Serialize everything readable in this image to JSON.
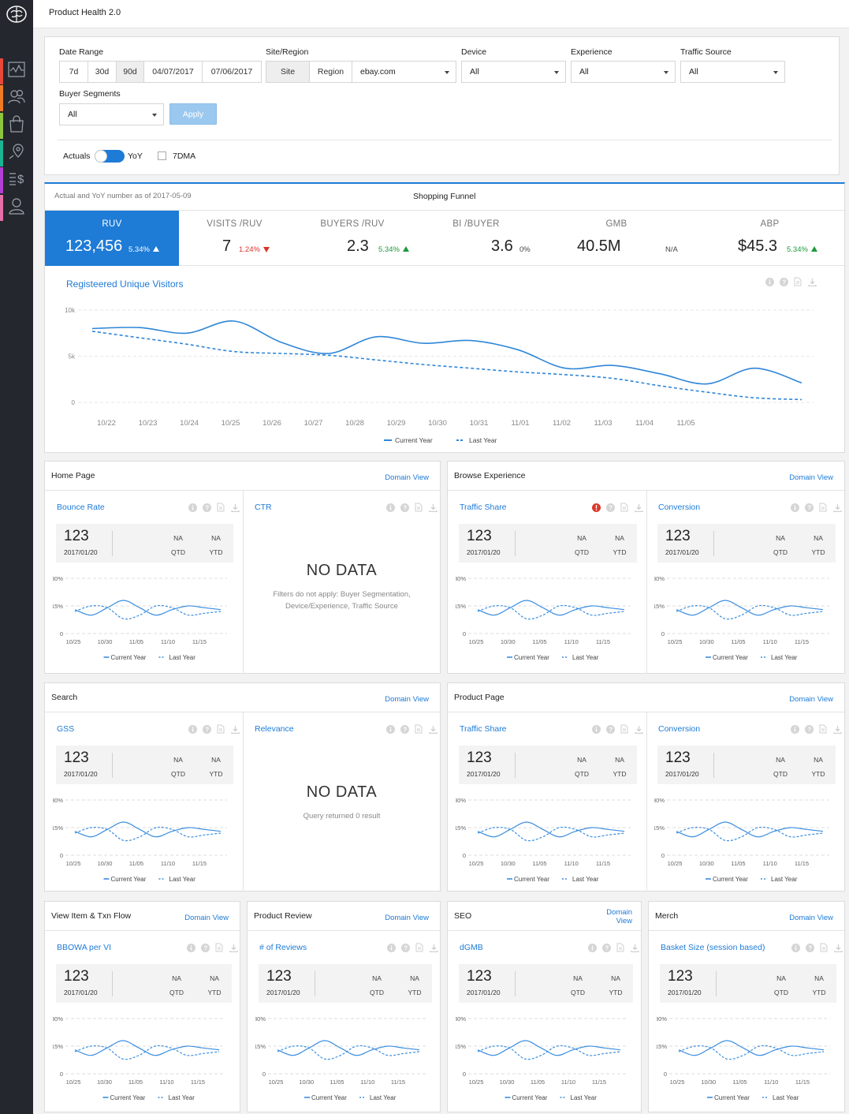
{
  "header": {
    "title": "Product Health 2.0"
  },
  "colors": {
    "accent": "#1e7bd6",
    "sidebar": "#24272d",
    "up": "#1c9a3a",
    "down": "#d9342b",
    "nav_bars": [
      "#e8483b",
      "#f07b22",
      "#8cc63e",
      "#1ab394",
      "#b03fd3",
      "#e56fa8"
    ]
  },
  "sidebar": {
    "items": [
      {
        "icon": "activity-chart-icon"
      },
      {
        "icon": "users-icon"
      },
      {
        "icon": "shopping-bag-icon"
      },
      {
        "icon": "location-pin-icon"
      },
      {
        "icon": "dollar-list-icon"
      },
      {
        "icon": "user-profile-icon"
      }
    ]
  },
  "filters": {
    "date_range_label": "Date Range",
    "ranges": [
      "7d",
      "30d",
      "90d"
    ],
    "active_range": "90d",
    "start_date": "04/07/2017",
    "end_date": "07/06/2017",
    "site_region_label": "Site/Region",
    "site_btn": "Site",
    "region_btn": "Region",
    "site_value": "ebay.com",
    "device_label": "Device",
    "device_value": "All",
    "experience_label": "Experience",
    "experience_value": "All",
    "traffic_label": "Traffic Source",
    "traffic_value": "All",
    "buyer_label": "Buyer Segments",
    "buyer_value": "All",
    "apply": "Apply",
    "actuals": "Actuals",
    "yoy": "YoY",
    "dma": "7DMA",
    "yoy_on": true,
    "dma_checked": false
  },
  "funnel": {
    "note": "Actual and YoY number as of 2017-05-09",
    "title": "Shopping Funnel",
    "kpis": [
      {
        "label": "RUV",
        "value": "123,456",
        "delta": "5.34%",
        "dir": "up",
        "active": true
      },
      {
        "label": "VISITS /RUV",
        "value": "7",
        "delta": "1.24%",
        "dir": "down"
      },
      {
        "label": "BUYERS /RUV",
        "value": "2.3",
        "delta": "5.34%",
        "dir": "up"
      },
      {
        "label": "BI /BUYER",
        "value": "3.6",
        "delta": "0%",
        "dir": "none"
      },
      {
        "label": "GMB",
        "value": "40.5M",
        "delta": "N/A",
        "dir": "none"
      },
      {
        "label": "ABP",
        "value": "$45.3",
        "delta": "5.34%",
        "dir": "up"
      }
    ]
  },
  "main_chart": {
    "title": "Registeered Unique Visitors",
    "legend_current": "Current Year",
    "legend_last": "Last Year"
  },
  "chart_data": [
    {
      "type": "line",
      "title": "Registeered Unique Visitors",
      "x": [
        "10/22",
        "10/23",
        "10/24",
        "10/25",
        "10/26",
        "10/27",
        "10/28",
        "10/29",
        "10/30",
        "10/31",
        "11/01",
        "11/02",
        "11/03",
        "11/04",
        "11/05"
      ],
      "y_ticks": [
        "10k",
        "5k",
        "0"
      ],
      "ylim": [
        0,
        10000
      ],
      "series": [
        {
          "name": "Current Year",
          "style": "solid",
          "values": [
            8000,
            8100,
            7500,
            8800,
            6500,
            5300,
            7100,
            6400,
            6700,
            5700,
            3700,
            4000,
            3100,
            2000,
            3700,
            2100
          ]
        },
        {
          "name": "Last Year",
          "style": "dashed",
          "values": [
            7700,
            7000,
            6300,
            5500,
            5300,
            5100,
            4600,
            4100,
            3700,
            3300,
            3000,
            2600,
            1800,
            1100,
            500,
            300
          ]
        }
      ]
    },
    {
      "type": "line",
      "x": [
        "10/25",
        "10/30",
        "11/05",
        "11/10",
        "11/15"
      ],
      "y_ticks": [
        "30%",
        "15%",
        "0"
      ],
      "ylim": [
        0,
        30
      ],
      "series": [
        {
          "name": "Current Year",
          "style": "solid",
          "values": [
            13,
            10,
            14,
            18,
            14,
            10,
            13,
            15,
            14,
            13
          ]
        },
        {
          "name": "Last Year",
          "style": "dashed",
          "values": [
            12,
            15,
            14,
            8,
            10,
            15,
            14,
            10,
            11,
            12
          ]
        }
      ]
    }
  ],
  "sections": [
    {
      "title": "Home Page",
      "domain": "Domain View",
      "cards": [
        {
          "title": "Bounce Rate",
          "value": "123",
          "date": "2017/01/20",
          "qtd": "NA",
          "ytd": "NA",
          "qtd_label": "QTD",
          "ytd_label": "YTD",
          "alert": false
        },
        {
          "title": "CTR",
          "nodata": "NO DATA",
          "note": "Filters do not apply: Buyer Segmentation, Device/Experience, Traffic Source"
        }
      ]
    },
    {
      "title": "Browse Experience",
      "domain": "Domain View",
      "cards": [
        {
          "title": "Traffic Share",
          "value": "123",
          "date": "2017/01/20",
          "qtd": "NA",
          "ytd": "NA",
          "qtd_label": "QTD",
          "ytd_label": "YTD",
          "alert": true
        },
        {
          "title": "Conversion",
          "value": "123",
          "date": "2017/01/20",
          "qtd": "NA",
          "ytd": "NA",
          "qtd_label": "QTD",
          "ytd_label": "YTD",
          "alert": false
        }
      ]
    },
    {
      "title": "Search",
      "domain": "Domain View",
      "cards": [
        {
          "title": "GSS",
          "value": "123",
          "date": "2017/01/20",
          "qtd": "NA",
          "ytd": "NA",
          "qtd_label": "QTD",
          "ytd_label": "YTD",
          "alert": false
        },
        {
          "title": "Relevance",
          "nodata": "NO DATA",
          "note": "Query returned 0 result"
        }
      ]
    },
    {
      "title": "Product Page",
      "domain": "Domain View",
      "cards": [
        {
          "title": "Traffic Share",
          "value": "123",
          "date": "2017/01/20",
          "qtd": "NA",
          "ytd": "NA",
          "qtd_label": "QTD",
          "ytd_label": "YTD",
          "alert": false
        },
        {
          "title": "Conversion",
          "value": "123",
          "date": "2017/01/20",
          "qtd": "NA",
          "ytd": "NA",
          "qtd_label": "QTD",
          "ytd_label": "YTD",
          "alert": false
        }
      ]
    },
    {
      "title": "View Item & Txn Flow",
      "domain": "Domain View",
      "cards": [
        {
          "title": "BBOWA per VI",
          "value": "123",
          "date": "2017/01/20",
          "qtd": "NA",
          "ytd": "NA",
          "qtd_label": "QTD",
          "ytd_label": "YTD",
          "alert": false
        }
      ]
    },
    {
      "title": "Product Review",
      "domain": "Domain View",
      "cards": [
        {
          "title": "# of Reviews",
          "value": "123",
          "date": "2017/01/20",
          "qtd": "NA",
          "ytd": "NA",
          "qtd_label": "QTD",
          "ytd_label": "YTD",
          "alert": false
        }
      ]
    },
    {
      "title": "SEO",
      "domain": "Domain View",
      "domain_lines": [
        "Domain",
        "View"
      ],
      "cards": [
        {
          "title": "dGMB",
          "value": "123",
          "date": "2017/01/20",
          "qtd": "NA",
          "ytd": "NA",
          "qtd_label": "QTD",
          "ytd_label": "YTD",
          "alert": false
        }
      ]
    },
    {
      "title": "Merch",
      "domain": "Domain View",
      "cards": [
        {
          "title": "Basket Size (session based)",
          "value": "123",
          "date": "2017/01/20",
          "qtd": "NA",
          "ytd": "NA",
          "qtd_label": "QTD",
          "ytd_label": "YTD",
          "alert": false
        }
      ]
    }
  ],
  "mini_legend": {
    "current": "Current Year",
    "last": "Last Year"
  }
}
